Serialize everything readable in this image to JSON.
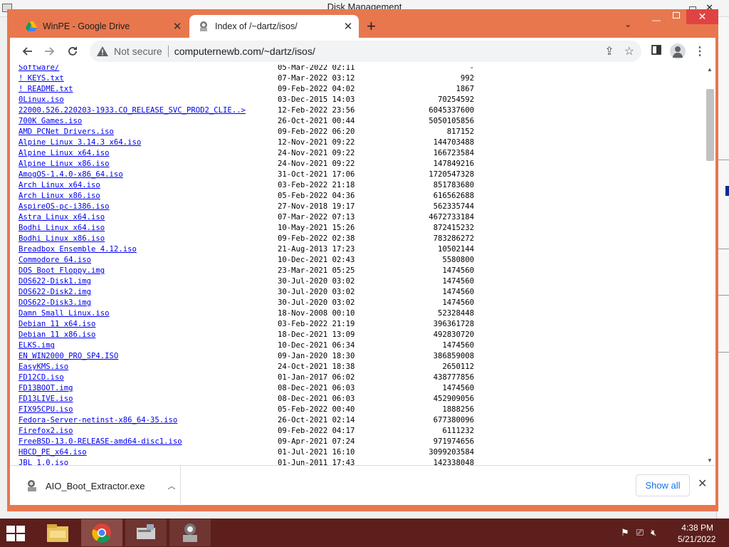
{
  "background_window": {
    "title": "Disk Management"
  },
  "tabs": [
    {
      "title": "WinPE - Google Drive",
      "icon": "google-drive-icon",
      "active": false
    },
    {
      "title": "Index of /~dartz/isos/",
      "icon": "site-favicon-icon",
      "active": true
    }
  ],
  "toolbar": {
    "security_label": "Not secure",
    "url": "computernewb.com/~dartz/isos/"
  },
  "files": [
    {
      "name": "Software/",
      "date": "05-Mar-2022 02:11",
      "size": "-"
    },
    {
      "name": "! KEYS.txt",
      "date": "07-Mar-2022 03:12",
      "size": "992"
    },
    {
      "name": "! README.txt",
      "date": "09-Feb-2022 04:02",
      "size": "1867"
    },
    {
      "name": "0Linux.iso",
      "date": "03-Dec-2015 14:03",
      "size": "70254592"
    },
    {
      "name": "22000.526.220203-1933.CO_RELEASE_SVC_PROD2_CLIE..>",
      "date": "12-Feb-2022 23:56",
      "size": "6045337600"
    },
    {
      "name": "700K Games.iso",
      "date": "26-Oct-2021 00:44",
      "size": "5050105856"
    },
    {
      "name": "AMD PCNet Drivers.iso",
      "date": "09-Feb-2022 06:20",
      "size": "817152"
    },
    {
      "name": "Alpine Linux 3.14.3 x64.iso",
      "date": "12-Nov-2021 09:22",
      "size": "144703488"
    },
    {
      "name": "Alpine Linux x64.iso",
      "date": "24-Nov-2021 09:22",
      "size": "166723584"
    },
    {
      "name": "Alpine Linux x86.iso",
      "date": "24-Nov-2021 09:22",
      "size": "147849216"
    },
    {
      "name": "AmogOS-1.4.0-x86_64.iso",
      "date": "31-Oct-2021 17:06",
      "size": "1720547328"
    },
    {
      "name": "Arch Linux x64.iso",
      "date": "03-Feb-2022 21:18",
      "size": "851783680"
    },
    {
      "name": "Arch Linux x86.iso",
      "date": "05-Feb-2022 04:36",
      "size": "616562688"
    },
    {
      "name": "AspireOS-pc-i386.iso",
      "date": "27-Nov-2018 19:17",
      "size": "562335744"
    },
    {
      "name": "Astra Linux x64.iso",
      "date": "07-Mar-2022 07:13",
      "size": "4672733184"
    },
    {
      "name": "Bodhi Linux x64.iso",
      "date": "10-May-2021 15:26",
      "size": "872415232"
    },
    {
      "name": "Bodhi Linux x86.iso",
      "date": "09-Feb-2022 02:38",
      "size": "783286272"
    },
    {
      "name": "Breadbox Ensemble 4.12.iso",
      "date": "21-Aug-2013 17:23",
      "size": "10502144"
    },
    {
      "name": "Commodore 64.iso",
      "date": "10-Dec-2021 02:43",
      "size": "5580800"
    },
    {
      "name": "DOS Boot Floppy.img",
      "date": "23-Mar-2021 05:25",
      "size": "1474560"
    },
    {
      "name": "DOS622-Disk1.img",
      "date": "30-Jul-2020 03:02",
      "size": "1474560"
    },
    {
      "name": "DOS622-Disk2.img",
      "date": "30-Jul-2020 03:02",
      "size": "1474560"
    },
    {
      "name": "DOS622-Disk3.img",
      "date": "30-Jul-2020 03:02",
      "size": "1474560"
    },
    {
      "name": "Damn Small Linux.iso",
      "date": "18-Nov-2008 00:10",
      "size": "52328448"
    },
    {
      "name": "Debian 11 x64.iso",
      "date": "03-Feb-2022 21:19",
      "size": "396361728"
    },
    {
      "name": "Debian 11 x86.iso",
      "date": "18-Dec-2021 13:09",
      "size": "492830720"
    },
    {
      "name": "ELKS.img",
      "date": "10-Dec-2021 06:34",
      "size": "1474560"
    },
    {
      "name": "EN_WIN2000_PRO_SP4.ISO",
      "date": "09-Jan-2020 18:30",
      "size": "386859008"
    },
    {
      "name": "EasyKMS.iso",
      "date": "24-Oct-2021 18:38",
      "size": "2650112"
    },
    {
      "name": "FD12CD.iso",
      "date": "01-Jan-2017 06:02",
      "size": "438777856"
    },
    {
      "name": "FD13BOOT.img",
      "date": "08-Dec-2021 06:03",
      "size": "1474560"
    },
    {
      "name": "FD13LIVE.iso",
      "date": "08-Dec-2021 06:03",
      "size": "452909056"
    },
    {
      "name": "FIX95CPU.iso",
      "date": "05-Feb-2022 00:40",
      "size": "1888256"
    },
    {
      "name": "Fedora-Server-netinst-x86_64-35.iso",
      "date": "26-Oct-2021 02:14",
      "size": "677380096"
    },
    {
      "name": "Firefox2.iso",
      "date": "09-Feb-2022 04:17",
      "size": "6111232"
    },
    {
      "name": "FreeBSD-13.0-RELEASE-amd64-disc1.iso",
      "date": "09-Apr-2021 07:24",
      "size": "971974656"
    },
    {
      "name": "HBCD_PE_x64.iso",
      "date": "01-Jul-2021 16:10",
      "size": "3099203584"
    },
    {
      "name": "JBL 1.0.iso",
      "date": "01-Jun-2011 17:43",
      "size": "142338048"
    }
  ],
  "downloads": {
    "filename": "AIO_Boot_Extractor.exe",
    "show_all_label": "Show all"
  },
  "taskbar": {
    "apps": [
      "file-explorer-icon",
      "chrome-icon",
      "disk-management-icon",
      "aio-boot-icon"
    ],
    "time": "4:38 PM",
    "date": "5/21/2022"
  },
  "colors": {
    "chrome_frame": "#e8774e",
    "taskbar": "#5c1f1c",
    "link": "#0000ee",
    "accent_blue": "#1a73e8"
  }
}
